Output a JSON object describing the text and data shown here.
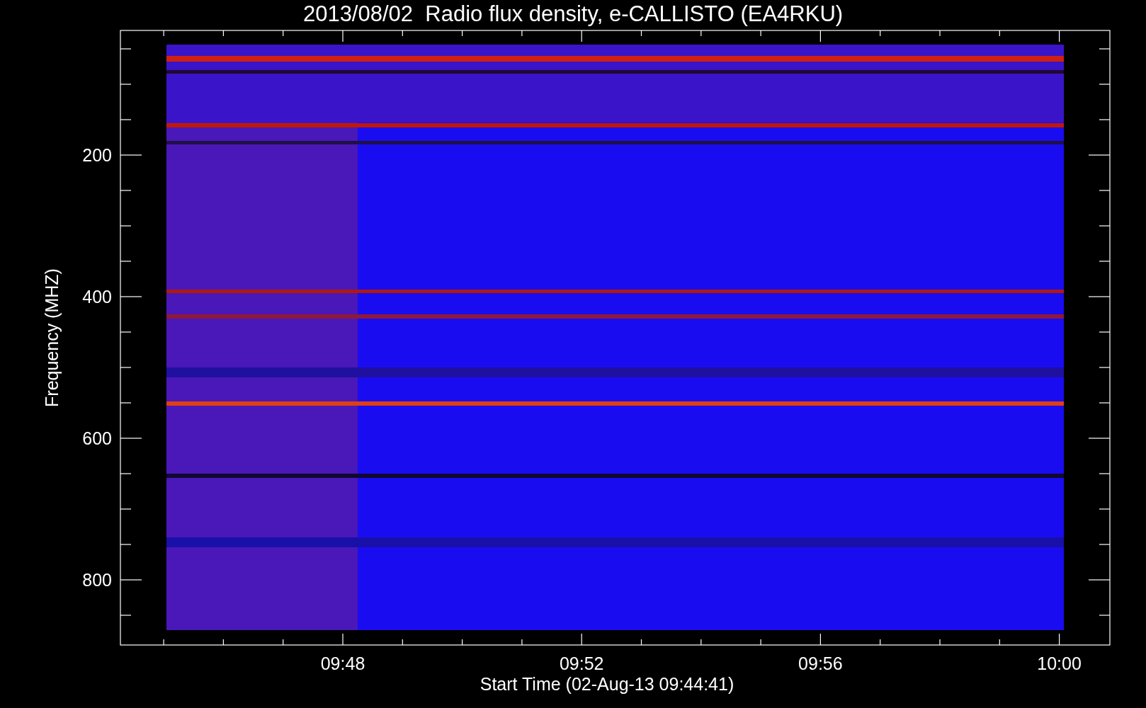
{
  "title": "2013/08/02  Radio flux density, e-CALLISTO (EA4RKU)",
  "plot": {
    "xlabel": "Start Time (02-Aug-13 09:44:41)",
    "ylabel": "Frequency (MHZ)",
    "xticks": [
      "09:48",
      "09:52",
      "09:56",
      "10:00"
    ],
    "yticks": [
      "200",
      "400",
      "600",
      "800"
    ]
  }
}
